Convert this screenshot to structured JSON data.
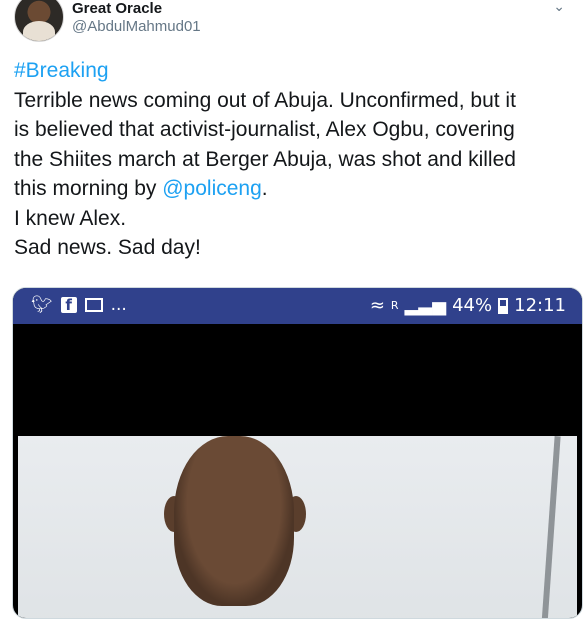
{
  "user": {
    "name": "Great Oracle",
    "handle": "@AbdulMahmud01"
  },
  "tweet": {
    "hashtag": "#Breaking",
    "line1": "Terrible news coming out of Abuja. Unconfirmed, but it",
    "line2": "is believed that activist-journalist, Alex Ogbu, covering",
    "line3": "the Shiites march at Berger Abuja, was shot and killed",
    "line4_pre": "this morning by ",
    "mention": "@policeng",
    "line4_post": ".",
    "line5": "I knew Alex.",
    "line6": "Sad news. Sad day!"
  },
  "status_bar": {
    "dots": "...",
    "signal_text": "R",
    "battery_percent": "44%",
    "time": "12:11"
  },
  "colors": {
    "link": "#1da1f2",
    "status_bar": "#30418c"
  }
}
